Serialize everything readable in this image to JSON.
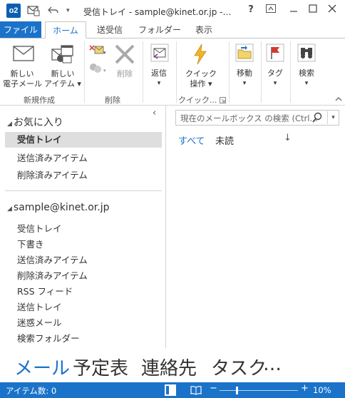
{
  "titlebar": {
    "title": "受信トレイ - sample@kinet.or.jp -…",
    "help": "?",
    "app_icon_label": "o2"
  },
  "ribbon_tabs": {
    "file": "ファイル",
    "tabs": [
      "ホーム",
      "送受信",
      "フォルダー",
      "表示"
    ],
    "active": "ホーム"
  },
  "ribbon": {
    "new_email": [
      "新しい",
      "電子メール"
    ],
    "new_items": [
      "新しい",
      "アイテム"
    ],
    "new_group_label": "新規作成",
    "delete_label": "削除",
    "delete_group_label": "削除",
    "reply": "返信",
    "quick_steps": [
      "クイック",
      "操作"
    ],
    "quick_group_label": "クイック...",
    "move": "移動",
    "tags": "タグ",
    "find": "検索"
  },
  "folder_pane": {
    "favorites_label": "お気に入り",
    "favorites": [
      {
        "label": "受信トレイ",
        "selected": true
      },
      {
        "label": "送信済みアイテム",
        "selected": false
      },
      {
        "label": "削除済みアイテム",
        "selected": false
      }
    ],
    "account": "sample@kinet.or.jp",
    "folders": [
      "受信トレイ",
      "下書き",
      "送信済みアイテム",
      "削除済みアイテム",
      "RSS フィード",
      "送信トレイ",
      "迷惑メール",
      "検索フォルダー"
    ]
  },
  "message_list": {
    "search_placeholder": "現在のメールボックス の検索 (Ctrl…",
    "filter_all": "すべて",
    "filter_unread": "未読",
    "sort_arrow": "↓"
  },
  "nav": {
    "items": [
      "メール",
      "予定表",
      "連絡先",
      "タスク",
      "…"
    ],
    "active": "メール"
  },
  "statusbar": {
    "item_count": "アイテム数: 0",
    "zoom": "10%",
    "zoom_fraction": 0.1
  },
  "colors": {
    "accent": "#1a73c9",
    "selection": "#dedede"
  }
}
